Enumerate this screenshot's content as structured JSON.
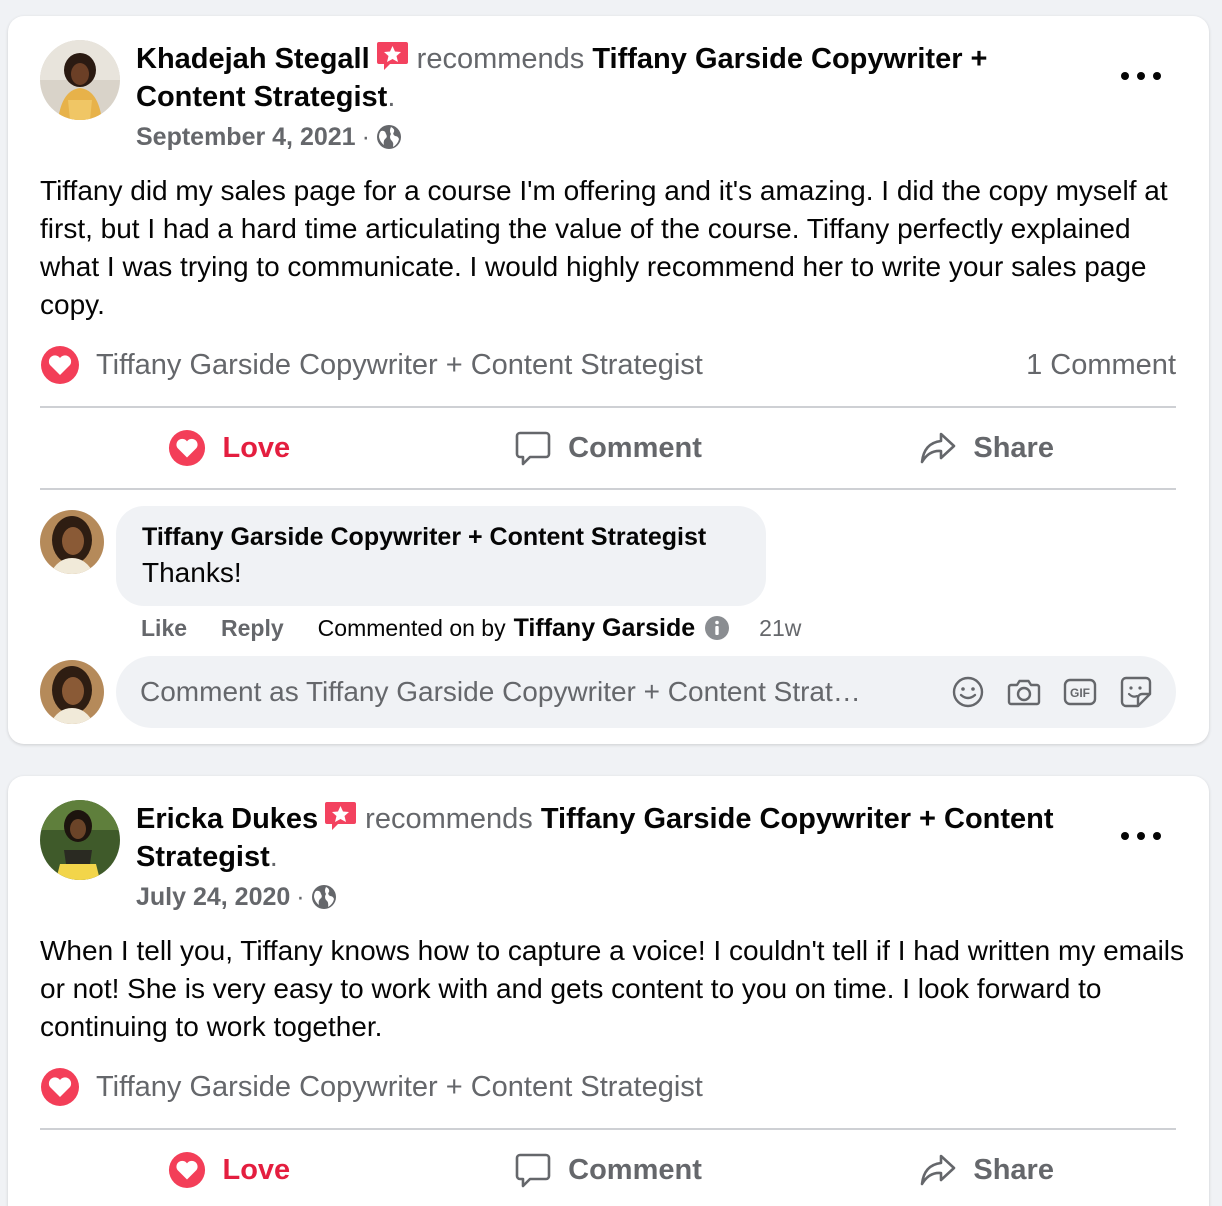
{
  "colors": {
    "background": "#f0f2f5",
    "card": "#ffffff",
    "text_primary": "#050505",
    "text_secondary": "#65676b",
    "love_red": "#e41e3f",
    "divider": "#ced0d4"
  },
  "reviews": [
    {
      "author": "Khadejah Stegall",
      "verb": "recommends",
      "page_line1": "Tiffany Garside Copywriter +",
      "page_line2": "Content Strategist",
      "period": ".",
      "date": "September 4, 2021",
      "separator": "·",
      "audience_icon": "globe-icon",
      "body": "Tiffany did my sales page for a course I'm offering and it's amazing. I did the copy myself at first, but I had a hard time articulating the value of the course. Tiffany perfectly explained what I was trying to communicate. I would highly recommend her to write your sales page copy.",
      "reactor": "Tiffany Garside Copywriter + Content Strategist",
      "comment_count": "1 Comment",
      "actions": {
        "love": "Love",
        "comment": "Comment",
        "share": "Share"
      },
      "comment": {
        "author": "Tiffany Garside Copywriter + Content Strategist",
        "text": "Thanks!",
        "like": "Like",
        "reply": "Reply",
        "commented_by": "Commented on by",
        "commented_by_name": "Tiffany Garside",
        "time": "21w"
      },
      "composer": {
        "placeholder": "Comment as Tiffany Garside Copywriter + Content Strat…",
        "icons": [
          "emoji-icon",
          "camera-icon",
          "gif-icon",
          "sticker-icon"
        ]
      }
    },
    {
      "author": "Ericka Dukes",
      "verb": "recommends",
      "page_line1": "Tiffany Garside Copywriter + Content",
      "page_line2": "Strategist",
      "period": ".",
      "date": "July 24, 2020",
      "separator": "·",
      "audience_icon": "globe-icon",
      "body": "When I tell you, Tiffany knows how to capture a voice! I couldn't tell if I had written my emails or not! She is very easy to work with and gets content to you on time. I look forward to continuing to work together.",
      "reactor": "Tiffany Garside Copywriter + Content Strategist",
      "actions": {
        "love": "Love",
        "comment": "Comment",
        "share": "Share"
      }
    }
  ]
}
